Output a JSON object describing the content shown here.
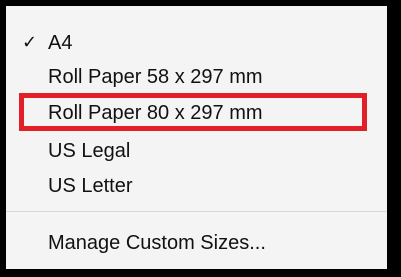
{
  "menu": {
    "items": [
      {
        "label": "A4",
        "checked": true,
        "check_glyph": "✓"
      },
      {
        "label": "Roll Paper 58 x 297 mm",
        "checked": false
      },
      {
        "label": "Roll Paper 80 x 297 mm",
        "checked": false,
        "highlighted": true
      },
      {
        "label": "US Legal",
        "checked": false
      },
      {
        "label": "US Letter",
        "checked": false
      }
    ],
    "footer_item": {
      "label": "Manage Custom Sizes..."
    }
  },
  "colors": {
    "menu_background": "#f4f4f4",
    "frame": "#000000",
    "highlight_border": "#e21f26",
    "text": "#111111"
  }
}
